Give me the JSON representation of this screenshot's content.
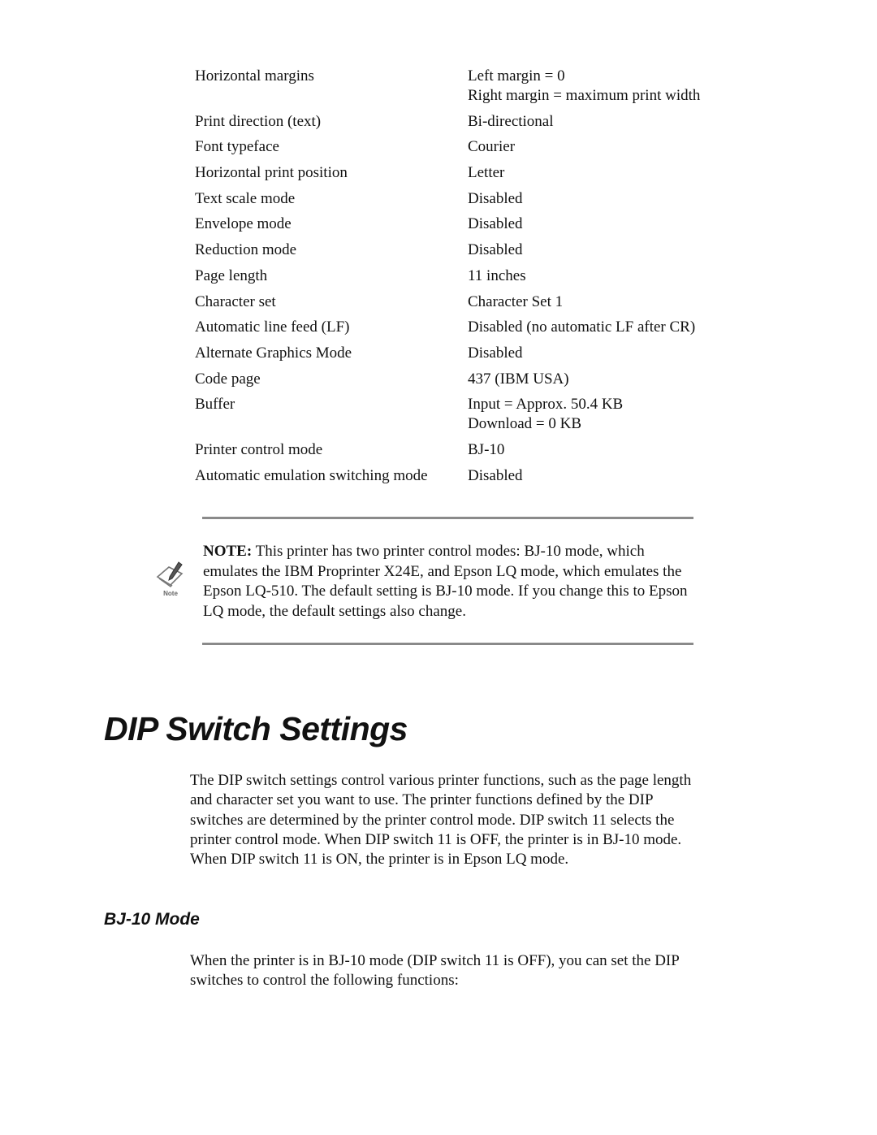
{
  "settings": [
    {
      "name": "Horizontal margins",
      "values": [
        "Left margin = 0",
        "Right margin = maximum print width"
      ]
    },
    {
      "name": "Print direction (text)",
      "values": [
        "Bi-directional"
      ]
    },
    {
      "name": "Font typeface",
      "values": [
        "Courier"
      ]
    },
    {
      "name": "Horizontal print position",
      "values": [
        "Letter"
      ]
    },
    {
      "name": "Text scale mode",
      "values": [
        "Disabled"
      ]
    },
    {
      "name": "Envelope mode",
      "values": [
        "Disabled"
      ]
    },
    {
      "name": "Reduction mode",
      "values": [
        "Disabled"
      ]
    },
    {
      "name": "Page length",
      "values": [
        "11 inches"
      ]
    },
    {
      "name": "Character set",
      "values": [
        "Character Set 1"
      ]
    },
    {
      "name": "Automatic line feed (LF)",
      "values": [
        "Disabled (no automatic LF after CR)"
      ]
    },
    {
      "name": "Alternate Graphics Mode",
      "values": [
        "Disabled"
      ]
    },
    {
      "name": "Code page",
      "values": [
        "437 (IBM USA)"
      ]
    },
    {
      "name": "Buffer",
      "values": [
        "Input = Approx. 50.4 KB",
        "Download = 0 KB"
      ]
    },
    {
      "name": "Printer control mode",
      "values": [
        "BJ-10"
      ]
    },
    {
      "name": "Automatic emulation switching mode",
      "values": [
        "Disabled"
      ]
    }
  ],
  "note": {
    "icon": "note-pencil-icon",
    "icon_label": "Note",
    "label": "NOTE:",
    "text": " This printer has two printer control modes: BJ-10 mode, which emulates the IBM Proprinter X24E, and Epson LQ mode, which emulates the Epson LQ-510. The default setting is BJ-10 mode. If you change this to Epson LQ mode, the default settings also change."
  },
  "section": {
    "title": "DIP Switch Settings",
    "intro": "The DIP switch settings control various printer functions, such as the page length and character set you want to use. The printer functions defined by the DIP switches are determined by the printer control mode. DIP switch 11 selects the printer control mode. When DIP switch 11 is OFF, the printer is in BJ-10 mode. When DIP switch 11 is ON, the printer is in Epson LQ mode."
  },
  "subsection": {
    "title": "BJ-10 Mode",
    "text": "When the printer is in BJ-10 mode (DIP switch 11 is OFF), you can set the DIP switches to control the following functions:"
  }
}
